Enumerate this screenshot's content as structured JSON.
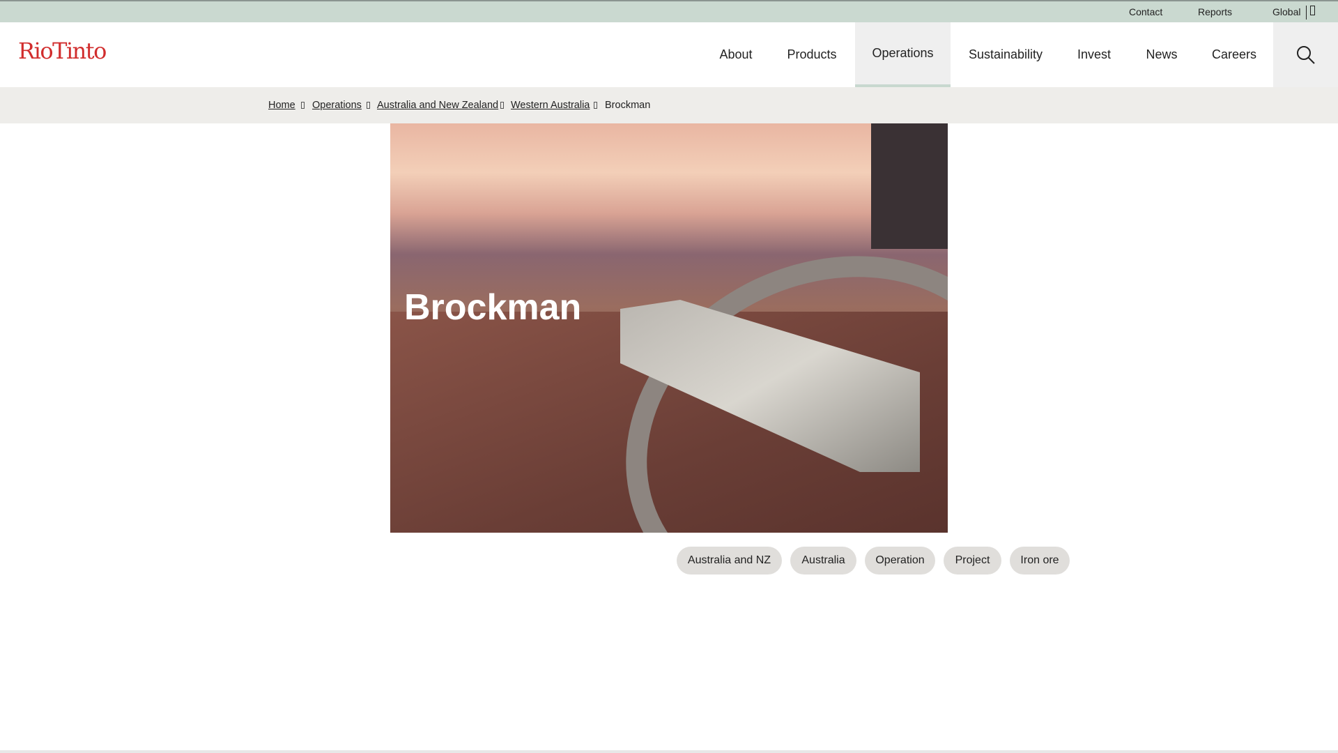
{
  "topbar": {
    "contact": "Contact",
    "reports": "Reports",
    "global": "Global"
  },
  "header": {
    "logo": "RioTinto",
    "nav": [
      "About",
      "Products",
      "Operations",
      "Sustainability",
      "Invest",
      "News",
      "Careers"
    ]
  },
  "breadcrumb": [
    "Home",
    "Operations",
    "Australia and New Zealand",
    "Western Australia",
    "Brockman"
  ],
  "hero": {
    "title": "Brockman"
  },
  "tags": [
    "Australia and NZ",
    "Australia",
    "Operation",
    "Project",
    "Iron ore"
  ]
}
